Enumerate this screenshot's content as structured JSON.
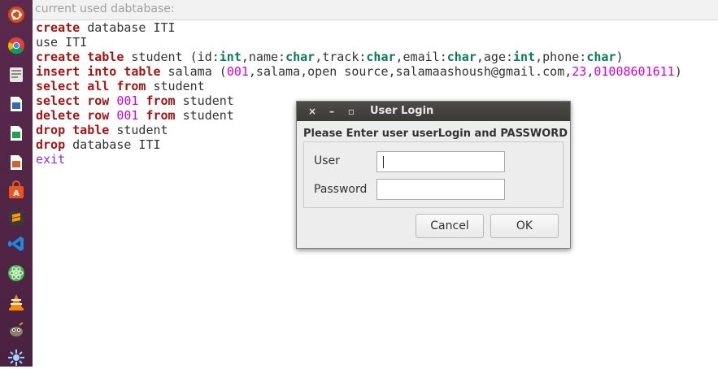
{
  "editor": {
    "title": "current used dabtabase:",
    "lines": [
      [
        {
          "t": "create",
          "c": "kw"
        },
        {
          "t": " database ITI",
          "c": "plain"
        }
      ],
      [
        {
          "t": "use ITI",
          "c": "plain"
        }
      ],
      [
        {
          "t": "create",
          "c": "kw"
        },
        {
          "t": " ",
          "c": "plain"
        },
        {
          "t": "table",
          "c": "kw"
        },
        {
          "t": " student (id:",
          "c": "plain"
        },
        {
          "t": "int",
          "c": "ty"
        },
        {
          "t": ",name:",
          "c": "plain"
        },
        {
          "t": "char",
          "c": "ty"
        },
        {
          "t": ",track:",
          "c": "plain"
        },
        {
          "t": "char",
          "c": "ty"
        },
        {
          "t": ",email:",
          "c": "plain"
        },
        {
          "t": "char",
          "c": "ty"
        },
        {
          "t": ",age:",
          "c": "plain"
        },
        {
          "t": "int",
          "c": "ty"
        },
        {
          "t": ",phone:",
          "c": "plain"
        },
        {
          "t": "char",
          "c": "ty"
        },
        {
          "t": ")",
          "c": "plain"
        }
      ],
      [
        {
          "t": "insert into table",
          "c": "kw"
        },
        {
          "t": " salama (",
          "c": "plain"
        },
        {
          "t": "001",
          "c": "num"
        },
        {
          "t": ",salama,open source,salamaashoush@gmail.com,",
          "c": "plain"
        },
        {
          "t": "23",
          "c": "num"
        },
        {
          "t": ",",
          "c": "plain"
        },
        {
          "t": "01008601611",
          "c": "num"
        },
        {
          "t": ")",
          "c": "plain"
        }
      ],
      [
        {
          "t": "select all from",
          "c": "kw"
        },
        {
          "t": " student",
          "c": "plain"
        }
      ],
      [
        {
          "t": "select row",
          "c": "kw"
        },
        {
          "t": " ",
          "c": "plain"
        },
        {
          "t": "001",
          "c": "num"
        },
        {
          "t": " ",
          "c": "plain"
        },
        {
          "t": "from",
          "c": "kw"
        },
        {
          "t": " student",
          "c": "plain"
        }
      ],
      [
        {
          "t": "delete row",
          "c": "kw"
        },
        {
          "t": " ",
          "c": "plain"
        },
        {
          "t": "001",
          "c": "num"
        },
        {
          "t": " ",
          "c": "plain"
        },
        {
          "t": "from",
          "c": "kw"
        },
        {
          "t": " student",
          "c": "plain"
        }
      ],
      [
        {
          "t": "drop table",
          "c": "kw"
        },
        {
          "t": " student",
          "c": "plain"
        }
      ],
      [
        {
          "t": "drop",
          "c": "kw"
        },
        {
          "t": " database ITI",
          "c": "plain"
        }
      ],
      [
        {
          "t": "exit",
          "c": "exit"
        }
      ]
    ]
  },
  "dialog": {
    "title": "User Login",
    "heading": "Please Enter user userLogin and PASSWORD",
    "user_label": "User",
    "user_value": "",
    "password_label": "Password",
    "password_value": "",
    "cancel_label": "Cancel",
    "ok_label": "OK",
    "close_glyph": "×",
    "minimize_glyph": "–",
    "maximize_glyph": "▫"
  },
  "launcher": {
    "icons": [
      "ubuntu-logo-icon",
      "chrome-icon",
      "files-icon",
      "writer-icon",
      "calc-icon",
      "impress-icon",
      "software-center-icon",
      "sublime-icon",
      "vscode-icon",
      "atom-icon",
      "vlc-icon",
      "gimp-icon",
      "gnome-icon"
    ]
  },
  "colors": {
    "keyword": "#a31515",
    "type": "#0a7a5a",
    "number": "#d400d4",
    "exit": "#8b2fd4",
    "launcher_bg": "#4a2141",
    "dialog_titlebar": "#3b3a37"
  }
}
